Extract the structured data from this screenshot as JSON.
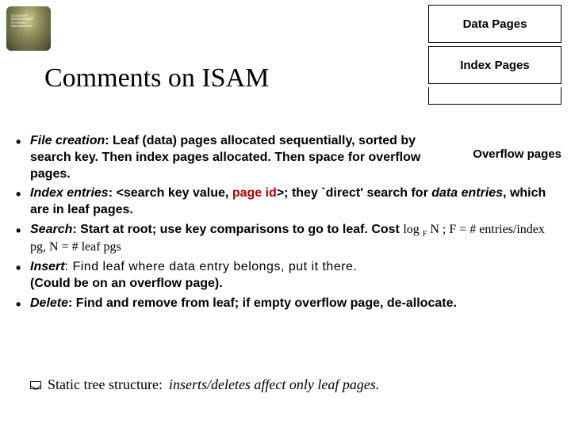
{
  "logo": {
    "line1": "DATABASE MANAGEMENT",
    "line2": "SYSTEMS",
    "line3": "Ramakrishnan"
  },
  "title": "Comments on ISAM",
  "sideboxes": {
    "data_pages": "Data Pages",
    "index_pages": "Index Pages",
    "overflow_pages": "Overflow pages"
  },
  "bullets": {
    "file_creation_term": "File creation",
    "file_creation_rest": ":  Leaf (data) pages allocated sequentially, sorted by search key. Then index pages allocated. Then space for overflow pages.",
    "index_entries_term": "Index entries",
    "index_entries_rest_a": ":  <search key value, ",
    "index_entries_pageid": "page id",
    "index_entries_rest_b": ">;  they  `direct' search for ",
    "index_entries_data": "data entries",
    "index_entries_rest_c": ", which are in leaf pages.",
    "search_term": "Search",
    "search_rest": ":  Start at root; use key comparisons to go to leaf. Cost ",
    "search_math_a": "log ",
    "search_math_sub": "F",
    "search_math_b": " N ; F = # entries/index pg, N = # leaf pgs",
    "insert_term": "Insert",
    "insert_find": ":  Find leaf where data entry belongs,  put it there.",
    "insert_tail": "(Could be on an overflow page).",
    "delete_term": "Delete",
    "delete_rest": ":  Find and remove from leaf; if empty overflow page, de-allocate."
  },
  "footer": {
    "lead": "Static tree structure:",
    "ital": "inserts/deletes affect only leaf pages."
  }
}
